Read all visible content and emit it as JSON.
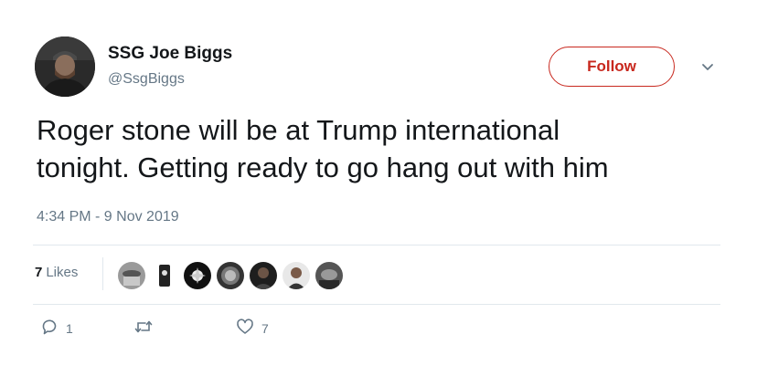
{
  "author": {
    "display_name": "SSG Joe Biggs",
    "handle": "@SsgBiggs"
  },
  "follow_button": {
    "label": "Follow",
    "accent": "#c8281e"
  },
  "tweet": {
    "text": "Roger stone will be at Trump international\ntonight. Getting ready to go hang out with him",
    "timestamp": "4:34 PM - 9 Nov 2019"
  },
  "stats": {
    "likes_count": "7",
    "likes_label": "Likes",
    "liker_avatars": [
      "liker-1",
      "liker-2",
      "liker-3",
      "liker-4",
      "liker-5",
      "liker-6",
      "liker-7"
    ]
  },
  "actions": {
    "reply_count": "1",
    "retweet_count": "",
    "like_count": "7"
  },
  "icons": {
    "reply": "reply-icon",
    "retweet": "retweet-icon",
    "like": "heart-icon",
    "caret": "chevron-down-icon"
  },
  "colors": {
    "text": "#14171a",
    "muted": "#657786",
    "divider": "#e1e8ed"
  }
}
